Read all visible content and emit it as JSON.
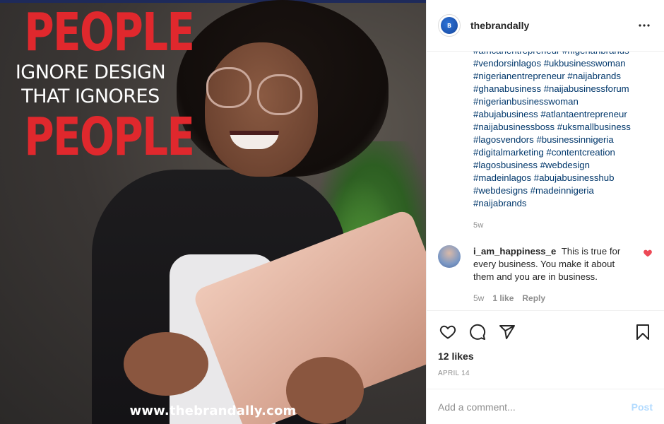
{
  "media": {
    "headline_line1": "PEOPLE",
    "headline_line2": "IGNORE DESIGN",
    "headline_line3": "THAT IGNORES",
    "headline_line4": "PEOPLE",
    "url_text": "www.thebrandally.com",
    "accent_color": "#e0282d"
  },
  "header": {
    "username": "thebrandally",
    "avatar_icon": "brandally-logo",
    "avatar_text": "brandly",
    "more_icon": "more-horizontal-icon"
  },
  "caption": {
    "hashtags": [
      "#africanentrepreneur #nigerianbrands",
      "#vendorsinlagos #ukbusinesswoman",
      "#nigerianentrepreneur #naijabrands",
      "#ghanabusiness #naijabusinessforum",
      "#nigerianbusinesswoman",
      "#abujabusiness #atlantaentrepreneur",
      "#naijabusinessboss #uksmallbusiness",
      "#lagosvendors #businessinnigeria",
      "#digitalmarketing #contentcreation",
      "#lagosbusiness #webdesign",
      "#madeinlagos #abujabusinesshub",
      "#webdesigns #madeinnigeria",
      "#naijabrands"
    ],
    "time": "5w"
  },
  "comment": {
    "username": "i_am_happiness_e",
    "text": "This is true for every business. You make it about them and you are in business.",
    "time": "5w",
    "likes": "1 like",
    "reply": "Reply",
    "heart_color": "#ed4956"
  },
  "actions": {
    "like_icon": "heart-outline-icon",
    "comment_icon": "comment-icon",
    "share_icon": "paper-plane-icon",
    "save_icon": "bookmark-icon",
    "likes_text": "12 likes",
    "date_text": "APRIL 14"
  },
  "add_comment": {
    "placeholder": "Add a comment...",
    "post_label": "Post",
    "post_color": "#b3dbff"
  }
}
